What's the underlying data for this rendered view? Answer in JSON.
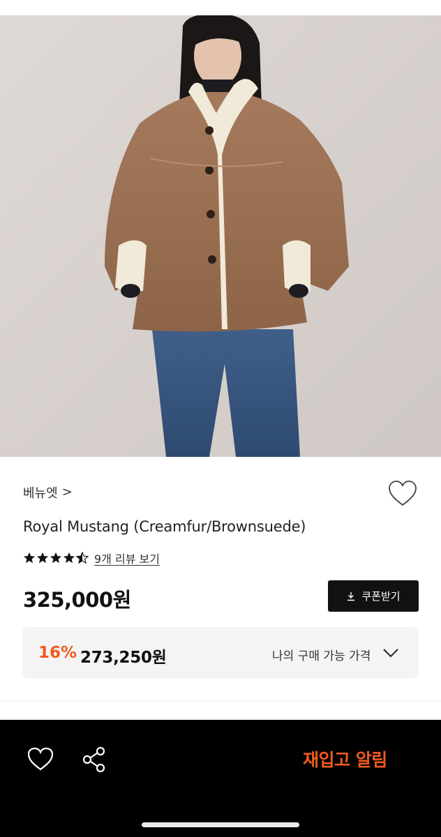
{
  "product": {
    "brand": "베뉴엣",
    "brand_chevron": ">",
    "title": "Royal Mustang (Creamfur/Brownsuede)",
    "rating": 4.5,
    "review_link": "9개 리뷰 보기",
    "price": "325,000원",
    "discount_rate": "16%",
    "discount_price": "273,250원",
    "my_price_label": "나의 구매 가능 가격"
  },
  "actions": {
    "coupon_label": "쿠폰받기",
    "restock_label": "재입고 알림"
  },
  "icons": {
    "wishlist": "heart-icon",
    "share": "share-icon",
    "download": "download-icon",
    "expand": "chevron-down-icon"
  },
  "colors": {
    "accent": "#f05a1e",
    "bottom_bar": "#000000",
    "coupon_button": "#111111",
    "discount_box": "#f4f4f5"
  }
}
